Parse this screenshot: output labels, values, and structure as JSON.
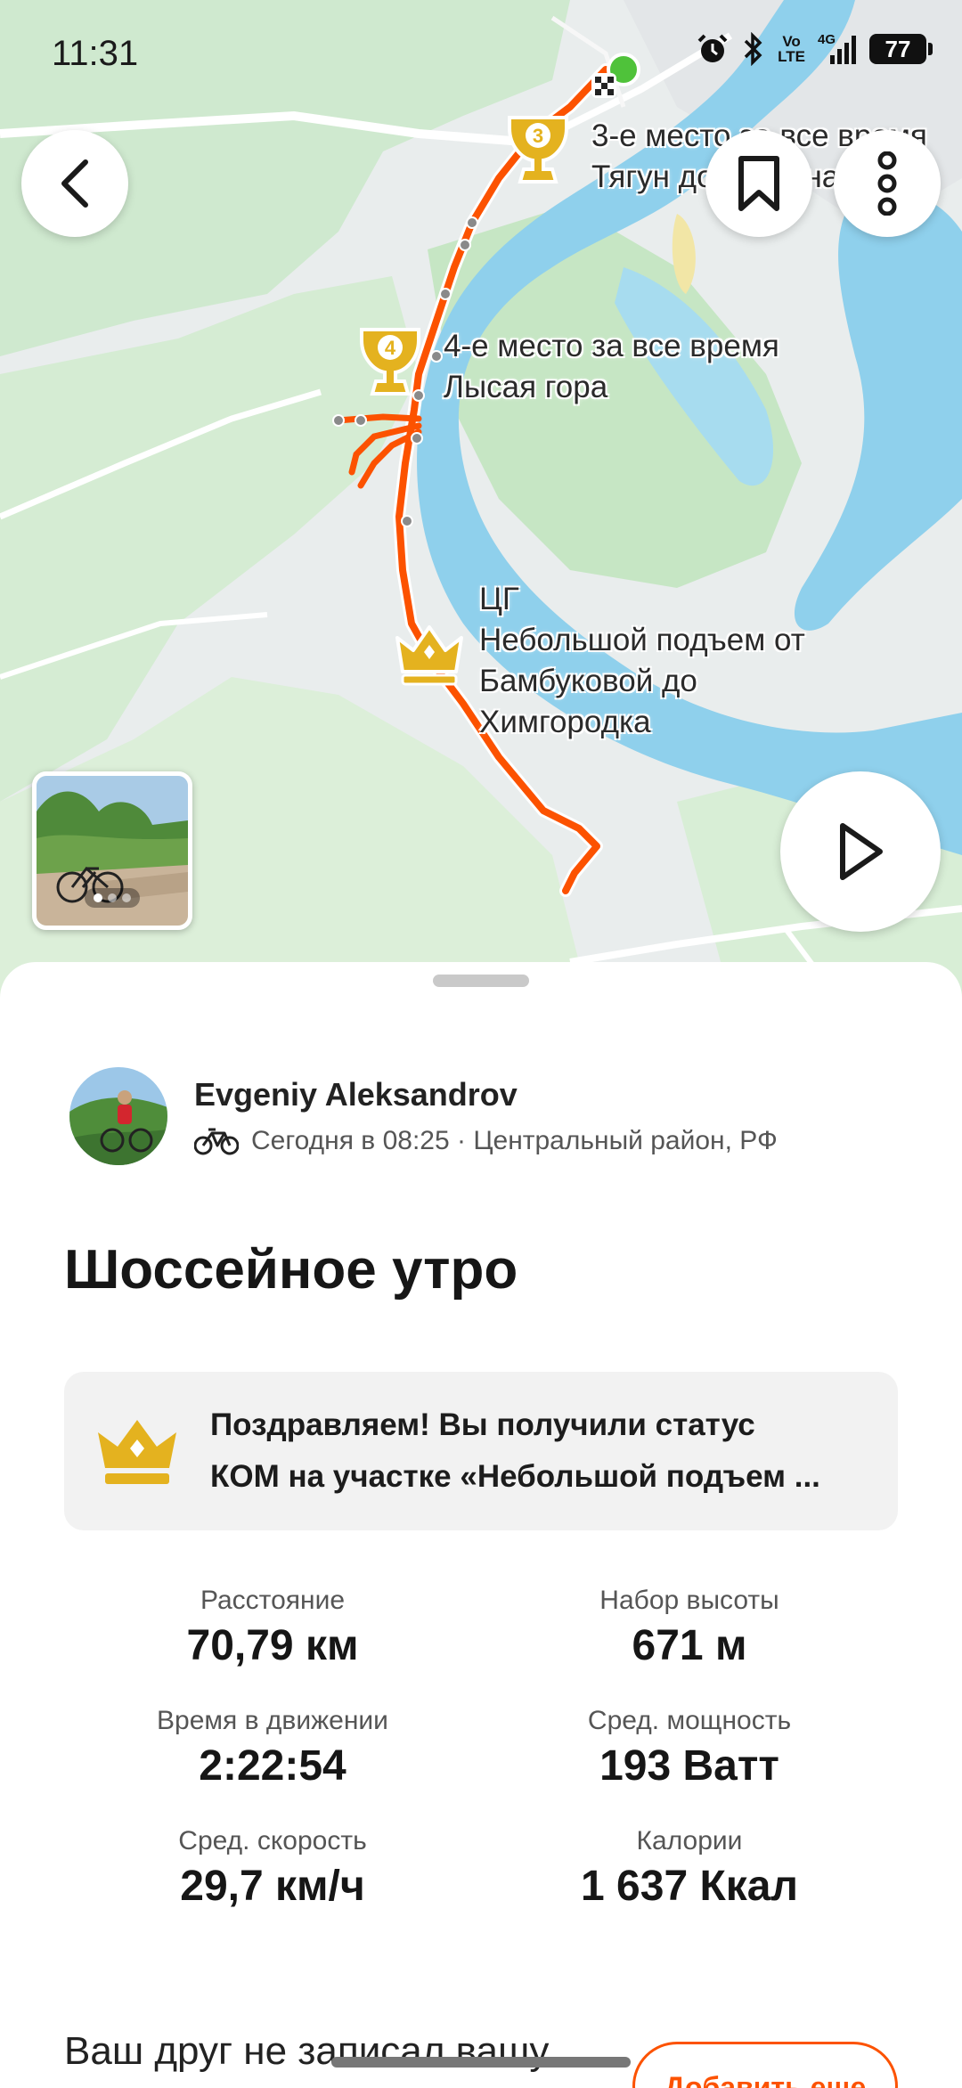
{
  "status_bar": {
    "time": "11:31",
    "icons": [
      "alarm-icon",
      "bluetooth-icon",
      "volte-icon",
      "4g-signal-icon",
      "battery-icon"
    ],
    "volte_label": "Vo\nLTE",
    "network_label": "4G",
    "battery_level": "77"
  },
  "map": {
    "route_color": "#fc5200",
    "segments": [
      {
        "badge": "3",
        "line1": "3-е место за все время",
        "line2": "Тягун до Кочкина"
      },
      {
        "badge": "4",
        "line1": "4-е место за все время",
        "line2": "Лысая гора"
      },
      {
        "badge": "crown",
        "line1": "ЦГ",
        "line2": "Небольшой подъем от",
        "line3": "Бамбуковой до",
        "line4": "Химгородка"
      }
    ]
  },
  "athlete": {
    "name": "Evgeniy Aleksandrov",
    "meta": "Сегодня в 08:25 · Центральный район, РФ"
  },
  "activity": {
    "title": "Шоссейное утро"
  },
  "achievement": {
    "line1": "Поздравляем! Вы получили статус",
    "line2": "КОМ на участке «Небольшой подъем ..."
  },
  "stats": [
    {
      "label": "Расстояние",
      "value": "70,79 км"
    },
    {
      "label": "Набор высоты",
      "value": "671 м"
    },
    {
      "label": "Время в движении",
      "value": "2:22:54"
    },
    {
      "label": "Сред. мощность",
      "value": "193 Ватт"
    },
    {
      "label": "Сред. скорость",
      "value": "29,7 км/ч"
    },
    {
      "label": "Калории",
      "value": "1 637 Ккал"
    }
  ],
  "friend_prompt": {
    "text": "Ваш друг не записал вашу",
    "button": "Добавить еще"
  },
  "colors": {
    "accent": "#fc5200",
    "water": "#8fd0ec",
    "park": "#c8e8c8",
    "trophy": "#e4b21f"
  }
}
